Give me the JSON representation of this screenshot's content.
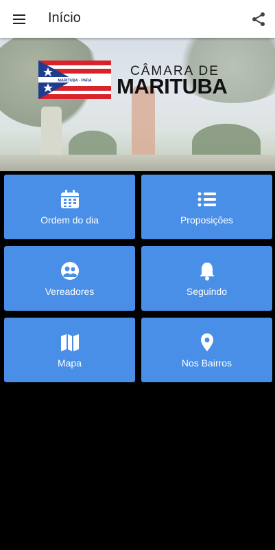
{
  "appbar": {
    "title": "Início",
    "menu_icon": "menu-icon",
    "share_icon": "share-icon"
  },
  "banner": {
    "brand_top": "CÂMARA DE",
    "brand_main": "MARITUBA",
    "flag_text": "MARITUBA - PARÁ"
  },
  "menu": [
    {
      "label": "Ordem do dia",
      "icon": "calendar-icon"
    },
    {
      "label": "Proposições",
      "icon": "list-icon"
    },
    {
      "label": "Vereadores",
      "icon": "group-icon"
    },
    {
      "label": "Seguindo",
      "icon": "bell-icon"
    },
    {
      "label": "Mapa",
      "icon": "map-icon"
    },
    {
      "label": "Nos Bairros",
      "icon": "location-pin-icon"
    }
  ],
  "colors": {
    "accent": "#4a8fe7",
    "appbar": "#ffffff",
    "background": "#000000"
  }
}
